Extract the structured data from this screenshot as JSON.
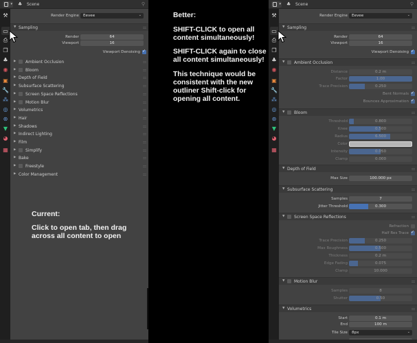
{
  "header": {
    "title": "Scene"
  },
  "render_engine": {
    "label": "Render Engine",
    "value": "Eevee"
  },
  "sampling": {
    "title": "Sampling",
    "render_label": "Render",
    "render_value": "64",
    "viewport_label": "Viewport",
    "viewport_value": "16",
    "denoise_label": "Viewport Denoising",
    "denoise_checked": true
  },
  "left_sections": [
    {
      "title": "Ambient Occlusion",
      "checkbox": true
    },
    {
      "title": "Bloom",
      "checkbox": true
    },
    {
      "title": "Depth of Field",
      "checkbox": false
    },
    {
      "title": "Subsurface Scattering",
      "checkbox": false
    },
    {
      "title": "Screen Space Reflections",
      "checkbox": true
    },
    {
      "title": "Motion Blur",
      "checkbox": true
    },
    {
      "title": "Volumetrics",
      "checkbox": false
    },
    {
      "title": "Hair",
      "checkbox": false
    },
    {
      "title": "Shadows",
      "checkbox": false
    },
    {
      "title": "Indirect Lighting",
      "checkbox": false
    },
    {
      "title": "Film",
      "checkbox": false
    },
    {
      "title": "Simplify",
      "checkbox": true
    },
    {
      "title": "Bake",
      "checkbox": false
    },
    {
      "title": "Freestyle",
      "checkbox": true
    },
    {
      "title": "Color Management",
      "checkbox": false
    }
  ],
  "ambient_occlusion": {
    "title": "Ambient Occlusion",
    "distance_label": "Distance",
    "distance": "0.2 m",
    "factor_label": "Factor",
    "factor": "1.00",
    "factor_fill": 1.0,
    "trace_label": "Trace Precision",
    "trace": "0.250",
    "trace_fill": 0.25,
    "bent_label": "Bent Normals",
    "bent": true,
    "bounces_label": "Bounces Approximation",
    "bounces": true
  },
  "bloom": {
    "title": "Bloom",
    "threshold_label": "Threshold",
    "threshold": "0.800",
    "threshold_fill": 0.08,
    "knee_label": "Knee",
    "knee": "0.500",
    "knee_fill": 0.5,
    "radius_label": "Radius",
    "radius": "6.500",
    "radius_fill": 0.65,
    "color_label": "Color",
    "color": "#b5b5b5",
    "intensity_label": "Intensity",
    "intensity": "0.050",
    "intensity_fill": 0.5,
    "clamp_label": "Clamp",
    "clamp": "0.000"
  },
  "dof": {
    "title": "Depth of Field",
    "max_size_label": "Max Size",
    "max_size": "100.000 px"
  },
  "sss": {
    "title": "Subsurface Scattering",
    "samples_label": "Samples",
    "samples": "7",
    "jitter_label": "Jitter Threshold",
    "jitter": "0.300",
    "jitter_fill": 0.3
  },
  "ssr": {
    "title": "Screen Space Reflections",
    "refraction_label": "Refraction",
    "refraction": false,
    "halfres_label": "Half Res Trace",
    "halfres": true,
    "trace_label": "Trace Precision",
    "trace": "0.250",
    "trace_fill": 0.25,
    "roughness_label": "Max Roughness",
    "roughness": "0.500",
    "roughness_fill": 0.5,
    "thickness_label": "Thickness",
    "thickness": "0.2 m",
    "edge_label": "Edge Fading",
    "edge": "0.075",
    "edge_fill": 0.14,
    "clamp_label": "Clamp",
    "clamp": "10.000"
  },
  "motion_blur": {
    "title": "Motion Blur",
    "samples_label": "Samples",
    "samples": "8",
    "shutter_label": "Shutter",
    "shutter": "0.50",
    "shutter_fill": 0.5
  },
  "volumetrics": {
    "title": "Volumetrics",
    "start_label": "Start",
    "start": "0.1 m",
    "end_label": "End",
    "end": "100 m",
    "tile_label": "Tile Size",
    "tile": "8px"
  },
  "annotations": {
    "current_title": "Current:",
    "current_body": "Click to open tab, then drag across all content to open",
    "better_title": "Better:",
    "better_p1": "SHIFT-CLICK to open all content simultaneously!",
    "better_p2": "SHIFT-CLICK again to close all content simultaneously!",
    "better_p3": "This technique would be consistent with the new outliner Shift-click for opening all content."
  },
  "tabs": [
    {
      "icon": "tool-icon",
      "glyph": "⚒",
      "color": "#dddddd"
    },
    {
      "icon": "render-icon",
      "glyph": "▭",
      "color": "#e0e0e0",
      "active": true
    },
    {
      "icon": "output-icon",
      "glyph": "⎙",
      "color": "#dddddd"
    },
    {
      "icon": "view-layer-icon",
      "glyph": "❐",
      "color": "#dddddd"
    },
    {
      "icon": "scene-icon",
      "glyph": "♣",
      "color": "#dddddd"
    },
    {
      "icon": "world-icon",
      "glyph": "◉",
      "color": "#d4555e"
    },
    {
      "icon": "object-icon",
      "glyph": "▣",
      "color": "#e8883c"
    },
    {
      "icon": "modifier-icon",
      "glyph": "🔧",
      "color": "#6a9fe0"
    },
    {
      "icon": "particles-icon",
      "glyph": "⁂",
      "color": "#6a9fe0"
    },
    {
      "icon": "physics-icon",
      "glyph": "◎",
      "color": "#6a9fe0"
    },
    {
      "icon": "constraints-icon",
      "glyph": "⊛",
      "color": "#6a9fe0"
    },
    {
      "icon": "data-icon",
      "glyph": "▼",
      "color": "#2fc47c"
    },
    {
      "icon": "material-icon",
      "glyph": "◕",
      "color": "#e06070"
    },
    {
      "icon": "texture-icon",
      "glyph": "▦",
      "color": "#e06070"
    }
  ]
}
